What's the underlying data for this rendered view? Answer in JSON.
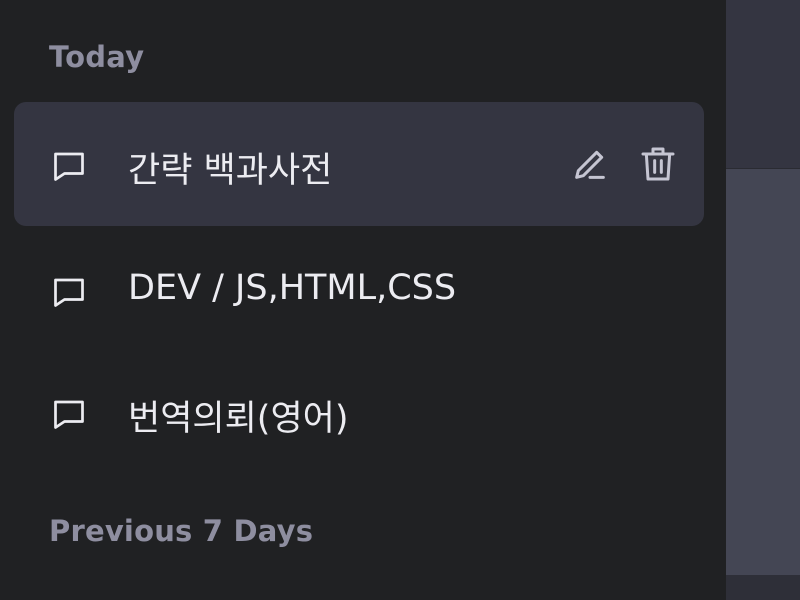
{
  "sidebar": {
    "sections": [
      {
        "label": "Today",
        "chats": [
          {
            "title": "간략 백과사전",
            "active": true,
            "icon": "chat-bubble-icon",
            "actions": [
              "pencil-icon",
              "trash-icon"
            ]
          },
          {
            "title": "DEV / JS,HTML,CSS",
            "active": false,
            "icon": "chat-bubble-icon"
          },
          {
            "title": "번역의뢰(영어)",
            "active": false,
            "icon": "chat-bubble-icon"
          }
        ]
      },
      {
        "label": "Previous 7 Days",
        "chats": []
      }
    ]
  },
  "colors": {
    "sidebar_bg": "#202123",
    "active_item_bg": "#343541",
    "section_label": "#8e8ea0",
    "item_text": "#ececf1"
  }
}
